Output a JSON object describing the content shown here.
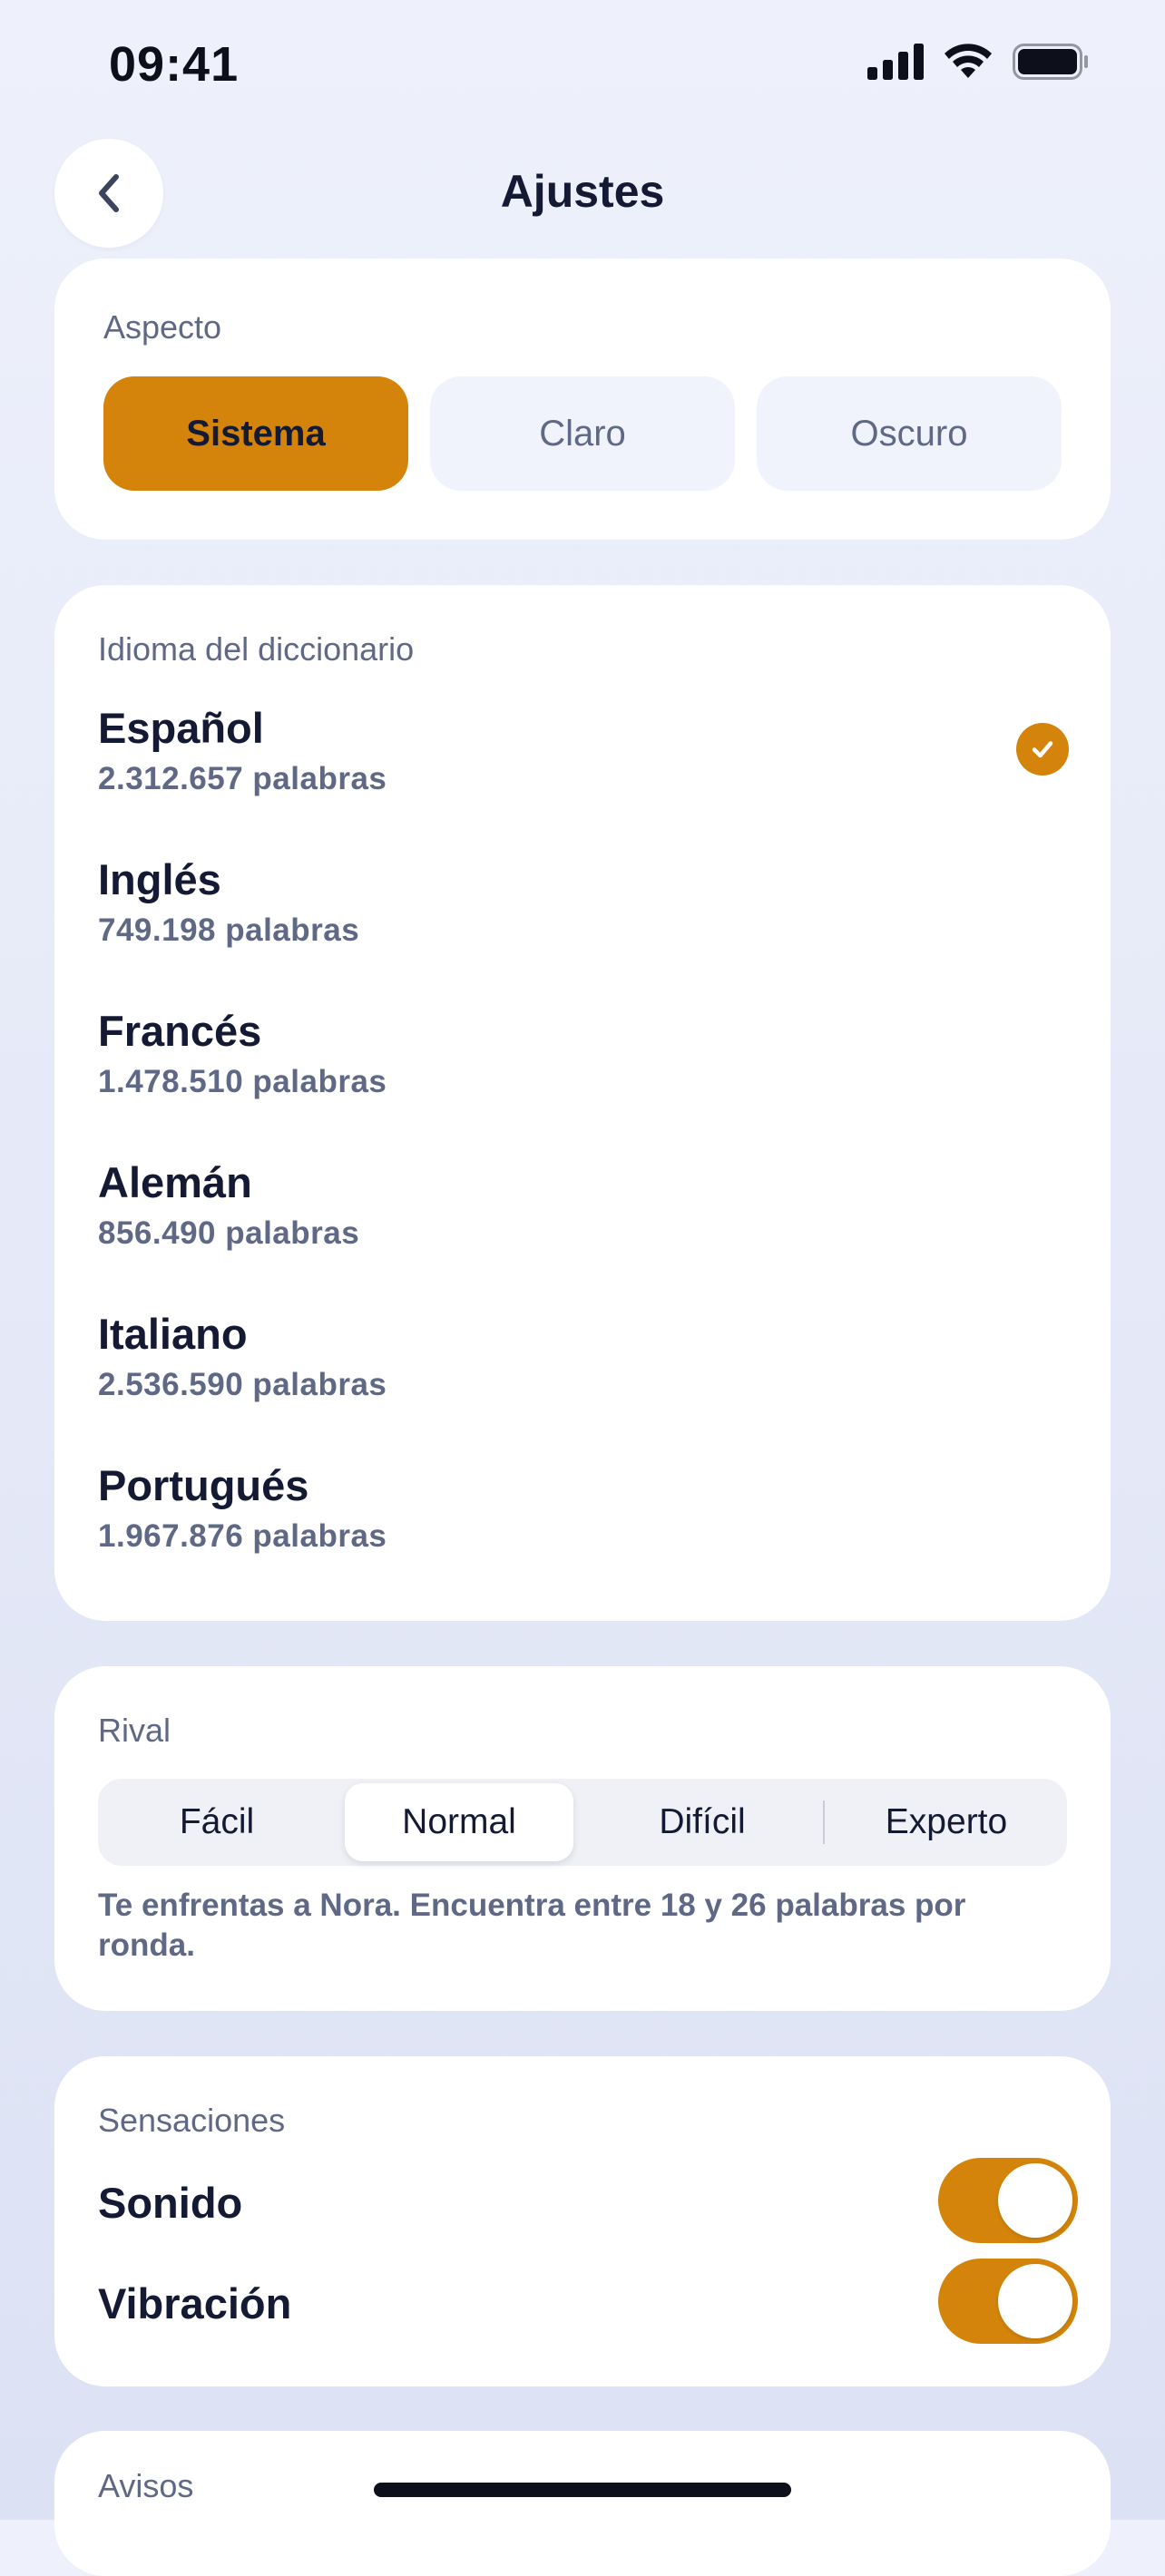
{
  "status_bar": {
    "time": "09:41",
    "icons": [
      "cellular-signal-icon",
      "wifi-icon",
      "battery-icon"
    ]
  },
  "header": {
    "title": "Ajustes",
    "back_icon": "chevron-left-icon"
  },
  "appearance": {
    "label": "Aspecto",
    "options": [
      {
        "label": "Sistema",
        "selected": true
      },
      {
        "label": "Claro",
        "selected": false
      },
      {
        "label": "Oscuro",
        "selected": false
      }
    ]
  },
  "dictionary": {
    "label": "Idioma del diccionario",
    "languages": [
      {
        "name": "Español",
        "count": "2.312.657 palabras",
        "selected": true
      },
      {
        "name": "Inglés",
        "count": "749.198 palabras",
        "selected": false
      },
      {
        "name": "Francés",
        "count": "1.478.510 palabras",
        "selected": false
      },
      {
        "name": "Alemán",
        "count": "856.490 palabras",
        "selected": false
      },
      {
        "name": "Italiano",
        "count": "2.536.590 palabras",
        "selected": false
      },
      {
        "name": "Portugués",
        "count": "1.967.876 palabras",
        "selected": false
      }
    ]
  },
  "rival": {
    "label": "Rival",
    "options": [
      {
        "label": "Fácil",
        "selected": false
      },
      {
        "label": "Normal",
        "selected": true
      },
      {
        "label": "Difícil",
        "selected": false
      },
      {
        "label": "Experto",
        "selected": false
      }
    ],
    "description": "Te enfrentas a Nora. Encuentra entre 18 y 26 palabras por ronda."
  },
  "sensations": {
    "label": "Sensaciones",
    "toggles": [
      {
        "label": "Sonido",
        "on": true
      },
      {
        "label": "Vibración",
        "on": true
      }
    ]
  },
  "notices": {
    "label": "Avisos"
  },
  "colors": {
    "accent": "#d4840a",
    "text_primary": "#141a33",
    "text_secondary": "#5f6885",
    "card": "#ffffff",
    "background": "#e6eaf8"
  }
}
